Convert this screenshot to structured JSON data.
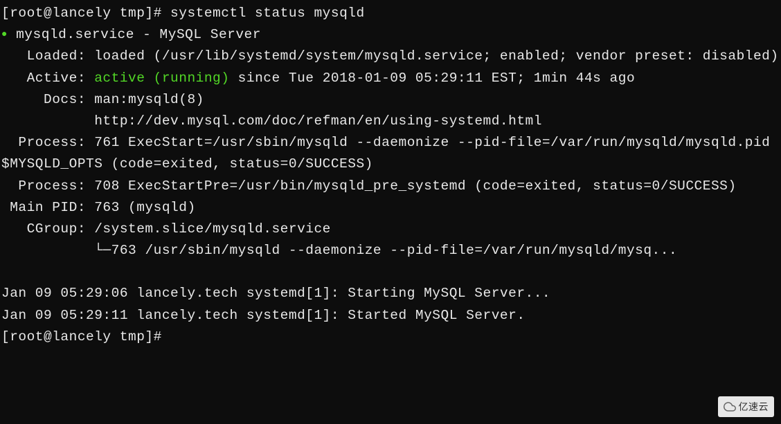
{
  "prompt_line1": "[root@lancely tmp]# systemctl status mysqld",
  "bullet": "●",
  "service_name": " mysqld.service - MySQL Server",
  "loaded_line": "   Loaded: loaded (/usr/lib/systemd/system/mysqld.service; enabled; vendor preset: disabled)",
  "active_label": "   Active: ",
  "active_status": "active (running)",
  "active_since": " since Tue 2018-01-09 05:29:11 EST; 1min 44s ago",
  "docs_line1": "     Docs: man:mysqld(8)",
  "docs_line2": "           http://dev.mysql.com/doc/refman/en/using-systemd.html",
  "process_line1": "  Process: 761 ExecStart=/usr/sbin/mysqld --daemonize --pid-file=/var/run/mysqld/mysqld.pid $MYSQLD_OPTS (code=exited, status=0/SUCCESS)",
  "process_line2": "  Process: 708 ExecStartPre=/usr/bin/mysqld_pre_systemd (code=exited, status=0/SUCCESS)",
  "mainpid_line": " Main PID: 763 (mysqld)",
  "cgroup_line1": "   CGroup: /system.slice/mysqld.service",
  "cgroup_line2": "           └─763 /usr/sbin/mysqld --daemonize --pid-file=/var/run/mysqld/mysq...",
  "blank": " ",
  "log_line1": "Jan 09 05:29:06 lancely.tech systemd[1]: Starting MySQL Server...",
  "log_line2": "Jan 09 05:29:11 lancely.tech systemd[1]: Started MySQL Server.",
  "prompt_line2": "[root@lancely tmp]# ",
  "watermark_text": "亿速云"
}
